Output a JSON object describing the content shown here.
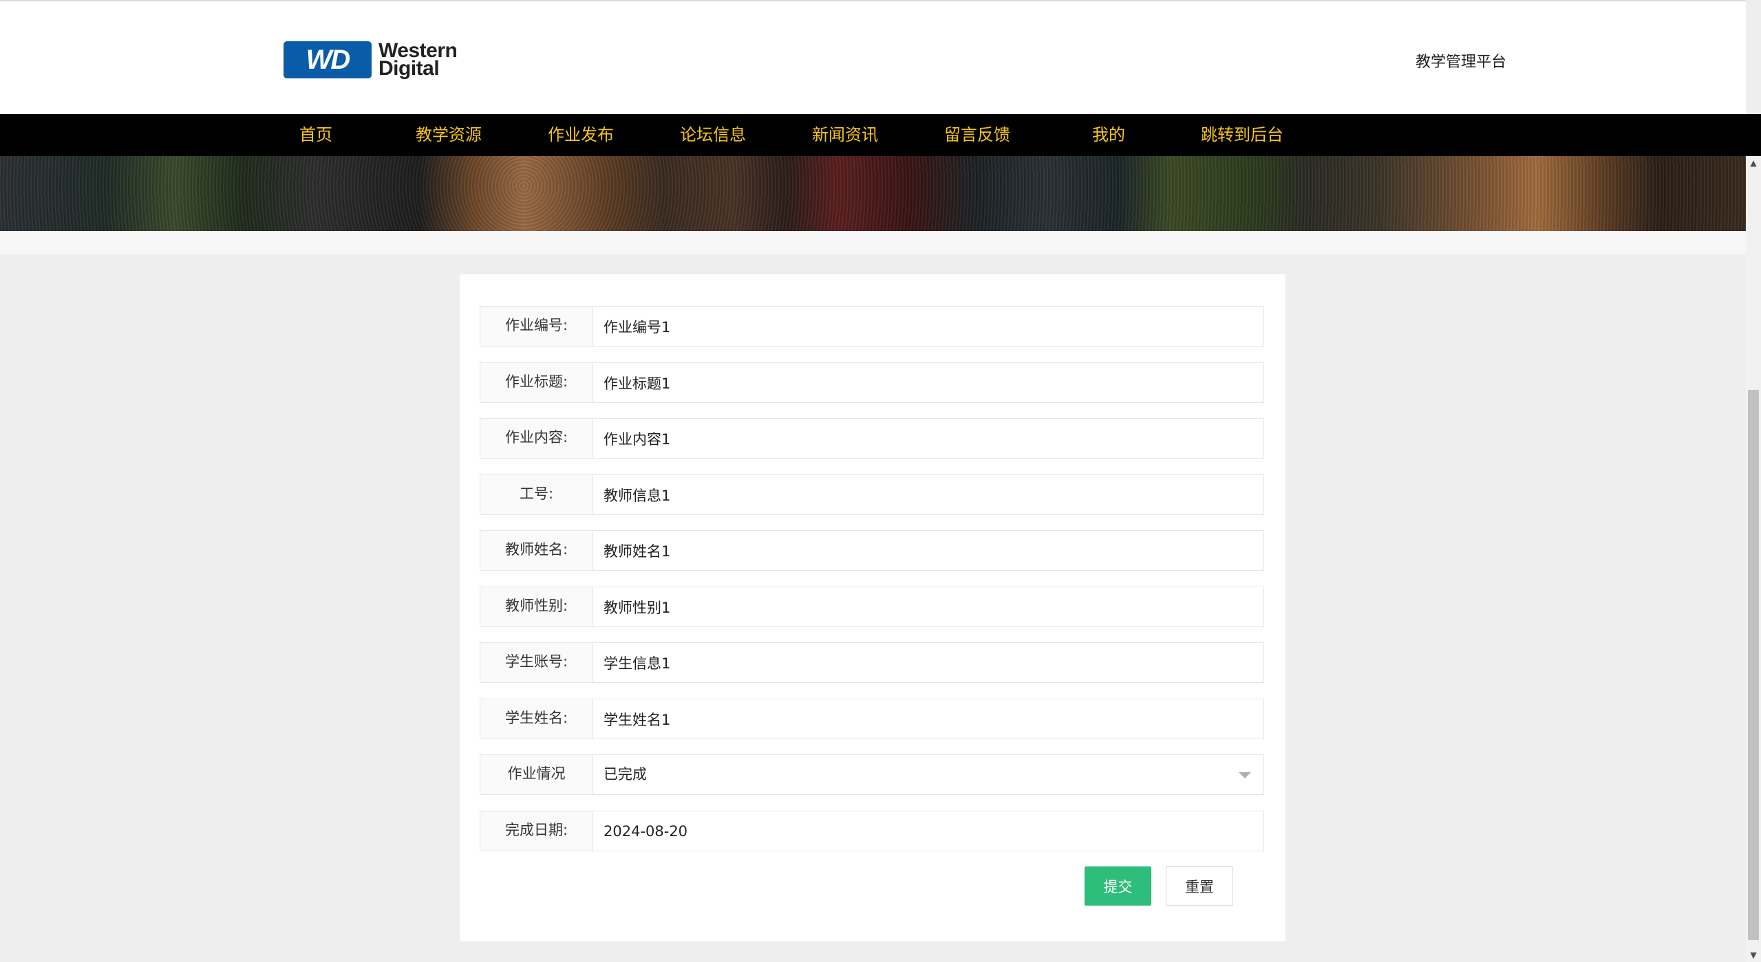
{
  "header": {
    "logo_badge": "WD",
    "logo_line1": "Western",
    "logo_line2": "Digital",
    "platform_title": "教学管理平台"
  },
  "nav": {
    "items": [
      {
        "label": "首页"
      },
      {
        "label": "教学资源"
      },
      {
        "label": "作业发布"
      },
      {
        "label": "论坛信息"
      },
      {
        "label": "新闻资讯"
      },
      {
        "label": "留言反馈"
      },
      {
        "label": "我的"
      },
      {
        "label": "跳转到后台"
      }
    ]
  },
  "form": {
    "fields": [
      {
        "label": "作业编号:",
        "value": "作业编号1"
      },
      {
        "label": "作业标题:",
        "value": "作业标题1"
      },
      {
        "label": "作业内容:",
        "value": "作业内容1"
      },
      {
        "label": "工号:",
        "value": "教师信息1"
      },
      {
        "label": "教师姓名:",
        "value": "教师姓名1"
      },
      {
        "label": "教师性别:",
        "value": "教师性别1"
      },
      {
        "label": "学生账号:",
        "value": "学生信息1"
      },
      {
        "label": "学生姓名:",
        "value": "学生姓名1"
      },
      {
        "label": "作业情况",
        "value": "已完成"
      },
      {
        "label": "完成日期:",
        "value": "2024-08-20"
      }
    ],
    "submit_label": "提交",
    "reset_label": "重置"
  },
  "colors": {
    "nav_bg": "#000000",
    "nav_text": "#f5c518",
    "submit_bg": "#2ebd7a",
    "logo_badge": "#0a5ca8"
  },
  "icons": {
    "scroll_up": "scroll-up-arrow-icon",
    "scroll_down": "scroll-down-arrow-icon",
    "select_caret": "chevron-down-icon"
  }
}
